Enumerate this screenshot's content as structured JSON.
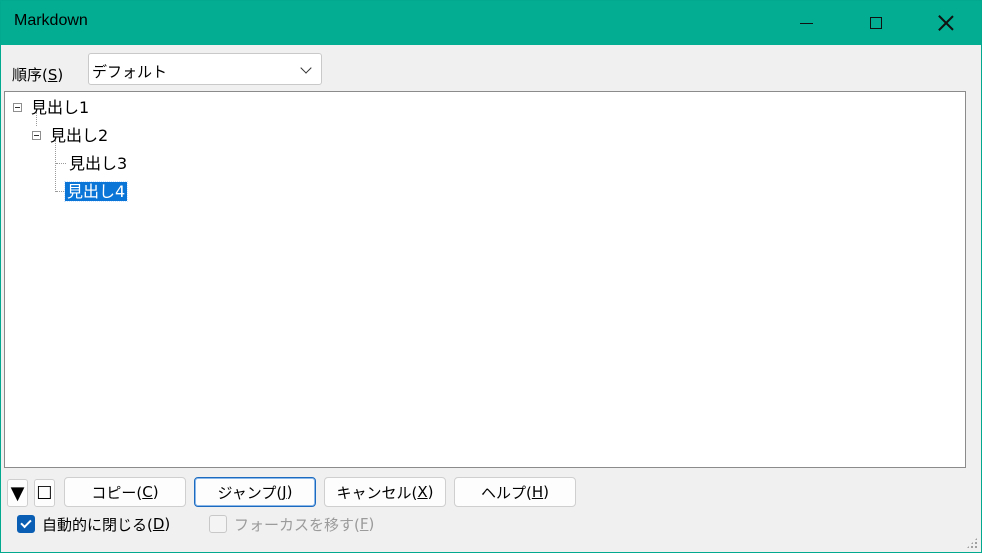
{
  "window": {
    "title": "Markdown"
  },
  "order": {
    "label": "順序(",
    "mnemonic": "S",
    "label_end": ")",
    "selected": "デフォルト"
  },
  "tree": {
    "nodes": [
      {
        "label": "見出し1",
        "expanded": true
      },
      {
        "label": "見出し2",
        "expanded": true
      },
      {
        "label": "見出し3"
      },
      {
        "label": "見出し4",
        "selected": true
      }
    ]
  },
  "toolbar": {
    "down_glyph": "▼",
    "square_glyph": "☐",
    "copy": {
      "label": "コピー(",
      "mnemonic": "C",
      "end": ")"
    },
    "jump": {
      "label": "ジャンプ(",
      "mnemonic": "J",
      "end": ")"
    },
    "cancel": {
      "label": "キャンセル(",
      "mnemonic": "X",
      "end": ")"
    },
    "help": {
      "label": "ヘルプ(",
      "mnemonic": "H",
      "end": ")"
    }
  },
  "options": {
    "auto_close": {
      "label": "自動的に閉じる(",
      "mnemonic": "D",
      "end": ")",
      "checked": true
    },
    "move_focus": {
      "label": "フォーカスを移す(",
      "mnemonic": "F",
      "end": ")",
      "checked": false,
      "disabled": true
    }
  },
  "colors": {
    "titlebar": "#02ad91",
    "selection": "#0a74d7",
    "checkbox": "#0a5fb4"
  }
}
